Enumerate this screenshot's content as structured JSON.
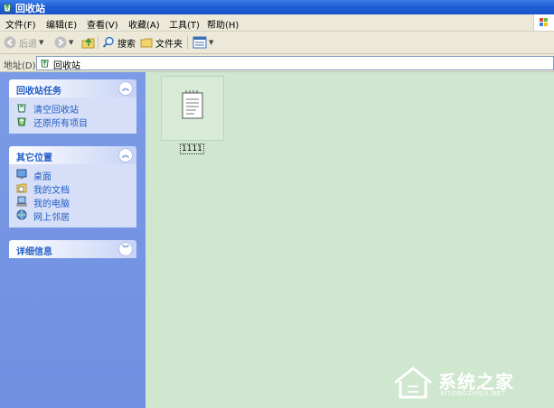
{
  "window": {
    "title": "回收站"
  },
  "menu": [
    "文件(F)",
    "编辑(E)",
    "查看(V)",
    "收藏(A)",
    "工具(T)",
    "帮助(H)"
  ],
  "toolbar": {
    "back": "后退",
    "search": "搜索",
    "folders": "文件夹"
  },
  "address": {
    "label": "地址(D)",
    "value": "回收站"
  },
  "tasks_panel": {
    "title": "回收站任务",
    "items": [
      {
        "label": "清空回收站",
        "icon": "empty-recycle-bin-icon"
      },
      {
        "label": "还原所有项目",
        "icon": "restore-icon"
      }
    ]
  },
  "places_panel": {
    "title": "其它位置",
    "items": [
      {
        "label": "桌面",
        "icon": "desktop-icon"
      },
      {
        "label": "我的文档",
        "icon": "my-documents-icon"
      },
      {
        "label": "我的电脑",
        "icon": "my-computer-icon"
      },
      {
        "label": "网上邻居",
        "icon": "network-places-icon"
      }
    ]
  },
  "details_panel": {
    "title": "详细信息"
  },
  "files": [
    {
      "name": "1111",
      "icon": "text-document-icon"
    }
  ],
  "watermark": {
    "name": "系统之家",
    "url": "XITONGZHIJIA.NET"
  },
  "colors": {
    "titlebar": "#1f5fd6",
    "taskpane": "#7b9be8",
    "content_bg": "#cfe6cf",
    "link": "#215dc6"
  }
}
